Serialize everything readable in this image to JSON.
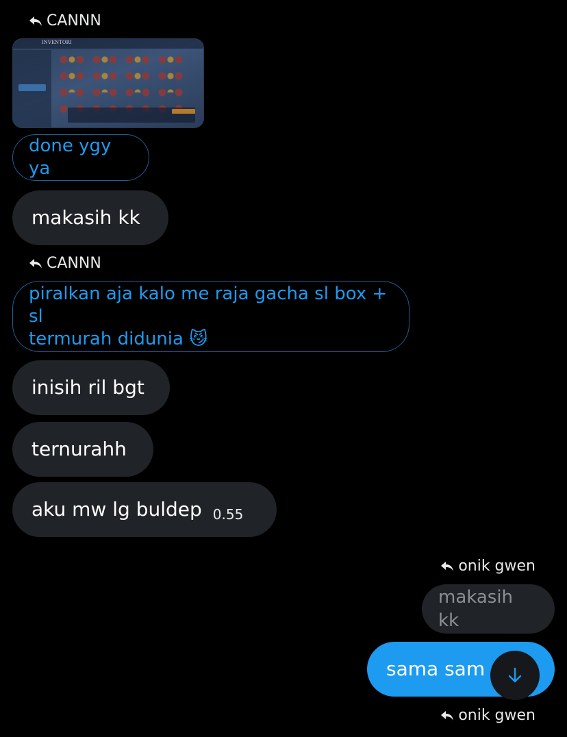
{
  "messages": {
    "reply1_name": "CANNN",
    "image_caption": "INVENTORI",
    "msg_done": "done ygy ya",
    "msg_makasih": "makasih kk",
    "reply2_name": "CANNN",
    "msg_piralkan_line1": "piralkan aja kalo me raja gacha sl box + sl",
    "msg_piralkan_line2": "termurah didunia",
    "msg_piralkan_emoji": "😼",
    "msg_inisih": "inisih ril bgt",
    "msg_ternurahh": "ternurahh",
    "msg_aku": "aku mw lg buldep",
    "msg_aku_time": "0.55",
    "reply3_name": "onik gwen",
    "msg_sent_quote": "makasih kk",
    "msg_sama": "sama sam",
    "reply4_name": "onik gwen"
  },
  "colors": {
    "accent": "#1d9bf0",
    "bubble": "#202327",
    "background": "#000000"
  },
  "icons": {
    "reply": "reply-arrow-icon",
    "scroll": "arrow-down-icon"
  }
}
